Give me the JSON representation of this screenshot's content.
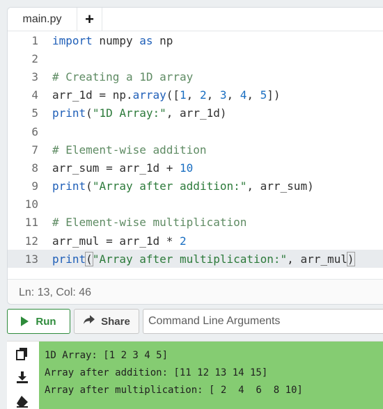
{
  "tabs": {
    "file_name": "main.py",
    "add_label": "+"
  },
  "code": {
    "line_numbers": [
      "1",
      "2",
      "3",
      "4",
      "5",
      "6",
      "7",
      "8",
      "9",
      "10",
      "11",
      "12",
      "13"
    ],
    "l1": {
      "kw1": "import",
      "mid": " numpy ",
      "kw2": "as",
      "end": " np"
    },
    "l3": "# Creating a 1D array",
    "l4": {
      "pre": "arr_1d = np.",
      "fn": "array",
      "open": "([",
      "n1": "1",
      "c1": ", ",
      "n2": "2",
      "c2": ", ",
      "n3": "3",
      "c3": ", ",
      "n4": "4",
      "c4": ", ",
      "n5": "5",
      "close": "])"
    },
    "l5": {
      "fn": "print",
      "open": "(",
      "str": "\"1D Array:\"",
      "rest": ", arr_1d)"
    },
    "l7": "# Element-wise addition",
    "l8": {
      "pre": "arr_sum = arr_1d + ",
      "num": "10"
    },
    "l9": {
      "fn": "print",
      "open": "(",
      "str": "\"Array after addition:\"",
      "rest": ", arr_sum)"
    },
    "l11": "# Element-wise multiplication",
    "l12": {
      "pre": "arr_mul = arr_1d * ",
      "num": "2"
    },
    "l13": {
      "fn": "print",
      "open": "(",
      "str": "\"Array after multiplication:\"",
      "rest": ", arr_mul",
      "close": ")"
    }
  },
  "status": {
    "position": "Ln: 13,  Col: 46"
  },
  "toolbar": {
    "run_label": "Run",
    "share_label": "Share",
    "cli_placeholder": "Command Line Arguments"
  },
  "output": {
    "lines": [
      "1D Array: [1 2 3 4 5]",
      "Array after addition: [11 12 13 14 15]",
      "Array after multiplication: [ 2  4  6  8 10]"
    ]
  },
  "colors": {
    "run_green": "#2e8b3b",
    "output_bg": "#85cc72",
    "keyword": "#1f5fb8",
    "string": "#2c7a3a",
    "comment": "#5e8b63"
  },
  "icons": {
    "run": "play-icon",
    "share": "share-arrow-icon",
    "copy": "copy-icon",
    "download": "download-icon",
    "clear": "eraser-icon"
  }
}
